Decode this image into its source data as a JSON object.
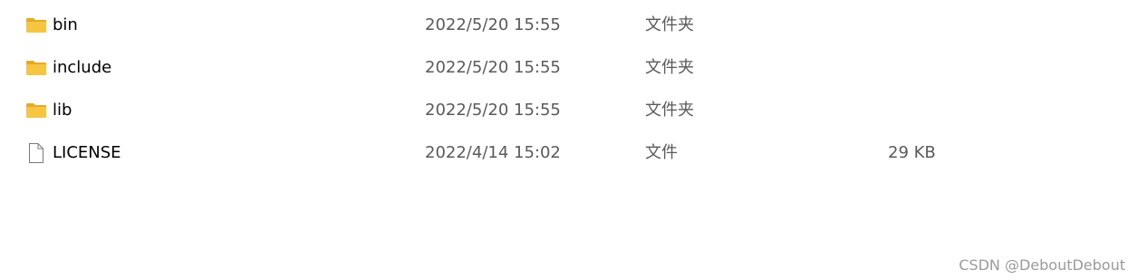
{
  "files": [
    {
      "name": "bin",
      "date": "2022/5/20 15:55",
      "type": "文件夹",
      "size": "",
      "icon": "folder-icon"
    },
    {
      "name": "include",
      "date": "2022/5/20 15:55",
      "type": "文件夹",
      "size": "",
      "icon": "folder-icon"
    },
    {
      "name": "lib",
      "date": "2022/5/20 15:55",
      "type": "文件夹",
      "size": "",
      "icon": "folder-icon"
    },
    {
      "name": "LICENSE",
      "date": "2022/4/14 15:02",
      "type": "文件",
      "size": "29 KB",
      "icon": "file-icon"
    }
  ],
  "watermark": "CSDN @DeboutDebout",
  "colors": {
    "folder_front": "#f6c643",
    "folder_back": "#e8a924",
    "secondary_text": "#5a5a5a"
  }
}
